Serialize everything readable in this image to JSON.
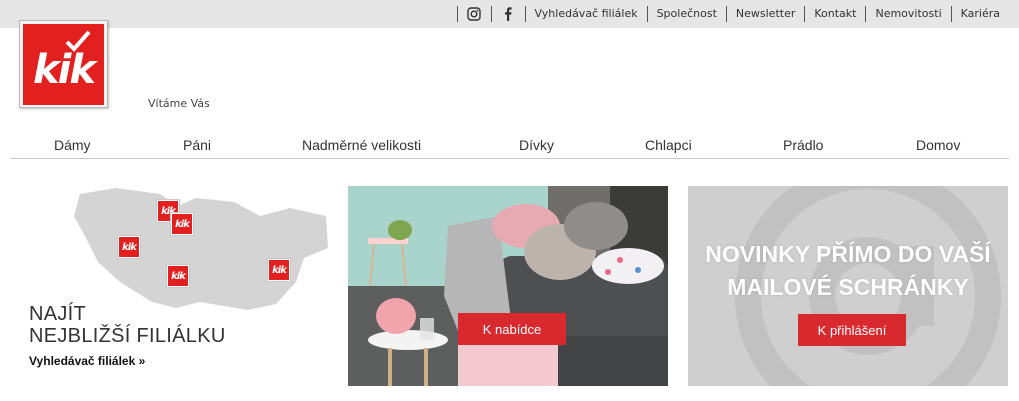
{
  "topbar": {
    "social": [
      {
        "icon": "instagram-icon"
      },
      {
        "icon": "facebook-icon"
      }
    ],
    "links": [
      "Vyhledávač filiálek",
      "Společnost",
      "Newsletter",
      "Kontakt",
      "Nemovitosti",
      "Kariéra"
    ]
  },
  "logo": {
    "text": "kik",
    "color": "#e2201f"
  },
  "welcome": "Vítáme Vás",
  "nav": [
    "Dámy",
    "Páni",
    "Nadměrné velikosti",
    "Dívky",
    "Chlapci",
    "Prádlo",
    "Domov"
  ],
  "tiles": {
    "map": {
      "title_line1": "NAJÍT",
      "title_line2": "NEJBLIŽŠÍ FILIÁLKU",
      "link": "Vyhledávač filiálek »",
      "pin_label": "kik"
    },
    "offer": {
      "button": "K nabídce"
    },
    "newsletter": {
      "title_line1": "NOVINKY PŘÍMO DO VAŠÍ",
      "title_line2": "MAILOVÉ SCHRÁNKY",
      "button": "K přihlášení"
    }
  },
  "colors": {
    "brand_red": "#e2201f",
    "button_red": "#d8292f",
    "topbar_bg": "#e6e6e6"
  }
}
